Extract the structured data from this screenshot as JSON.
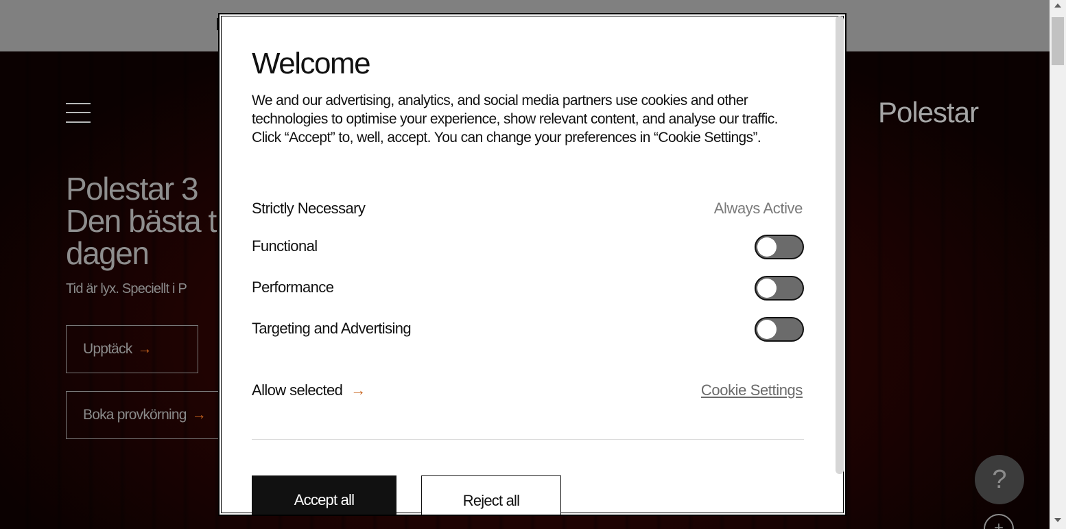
{
  "hero": {
    "brand": "Polestar",
    "title_line1": "Polestar 3",
    "title_line2": "Den bästa t",
    "title_line3": "dagen",
    "subtitle": "Tid är lyx. Speciellt i P",
    "discover_label": "Upptäck",
    "testdrive_label": "Boka provkörning",
    "arrow": "→",
    "help_glyph": "?",
    "plus_glyph": "+"
  },
  "modal": {
    "title": "Welcome",
    "description": "We and our advertising, analytics, and social media partners use cookies and other technologies to optimise your experience, show relevant content, and analyse our traffic. Click “Accept” to, well, accept. You can change your preferences in “Cookie Settings”.",
    "categories": [
      {
        "label": "Strictly Necessary",
        "status": "Always Active"
      },
      {
        "label": "Functional",
        "enabled": false
      },
      {
        "label": "Performance",
        "enabled": false
      },
      {
        "label": "Targeting and Advertising",
        "enabled": false
      }
    ],
    "allow_selected": "Allow selected",
    "arrow": "→",
    "cookie_settings": "Cookie Settings",
    "accept_all": "Accept all",
    "reject_all": "Reject all"
  },
  "colors": {
    "accent_arrow": "#c9651f",
    "toggle_off": "#6b6b6b",
    "hero_bg": "#1f0302"
  }
}
